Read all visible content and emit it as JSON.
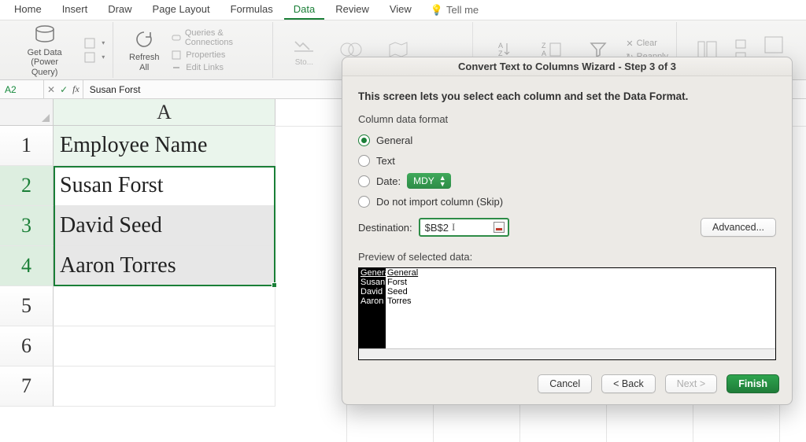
{
  "ribbon": {
    "tabs": [
      "Home",
      "Insert",
      "Draw",
      "Page Layout",
      "Formulas",
      "Data",
      "Review",
      "View"
    ],
    "active_tab": "Data",
    "tell_me": "Tell me",
    "get_data_label_l1": "Get Data (Power",
    "get_data_label_l2": "Query)",
    "refresh_label_l1": "Refresh",
    "refresh_label_l2": "All",
    "queries_label": "Queries & Connections",
    "properties_label": "Properties",
    "edit_links_label": "Edit Links",
    "sort_labels": {
      "clear": "Clear",
      "reapply": "Reapply"
    }
  },
  "formula_bar": {
    "name_box": "A2",
    "value": "Susan Forst"
  },
  "sheet": {
    "col_header": "A",
    "rows": [
      {
        "num": "1",
        "val": "Employee Name",
        "header": true
      },
      {
        "num": "2",
        "val": "Susan Forst",
        "sel": true
      },
      {
        "num": "3",
        "val": "David Seed",
        "sel": true
      },
      {
        "num": "4",
        "val": "Aaron Torres",
        "sel": true
      },
      {
        "num": "5",
        "val": ""
      },
      {
        "num": "6",
        "val": ""
      },
      {
        "num": "7",
        "val": ""
      }
    ]
  },
  "dialog": {
    "title": "Convert Text to Columns Wizard - Step 3 of 3",
    "heading": "This screen lets you select each column and set the Data Format.",
    "section": "Column data format",
    "opt_general": "General",
    "opt_text": "Text",
    "opt_date": "Date:",
    "date_format": "MDY",
    "opt_skip": "Do not import column (Skip)",
    "destination_label": "Destination:",
    "destination_value": "$B$2",
    "advanced": "Advanced...",
    "preview_label": "Preview of selected data:",
    "preview": {
      "col1": [
        "Genera",
        "Susan",
        "David",
        "Aaron"
      ],
      "col2": [
        "General",
        "Forst",
        "Seed",
        "Torres"
      ]
    },
    "buttons": {
      "cancel": "Cancel",
      "back": "< Back",
      "next": "Next >",
      "finish": "Finish"
    }
  }
}
